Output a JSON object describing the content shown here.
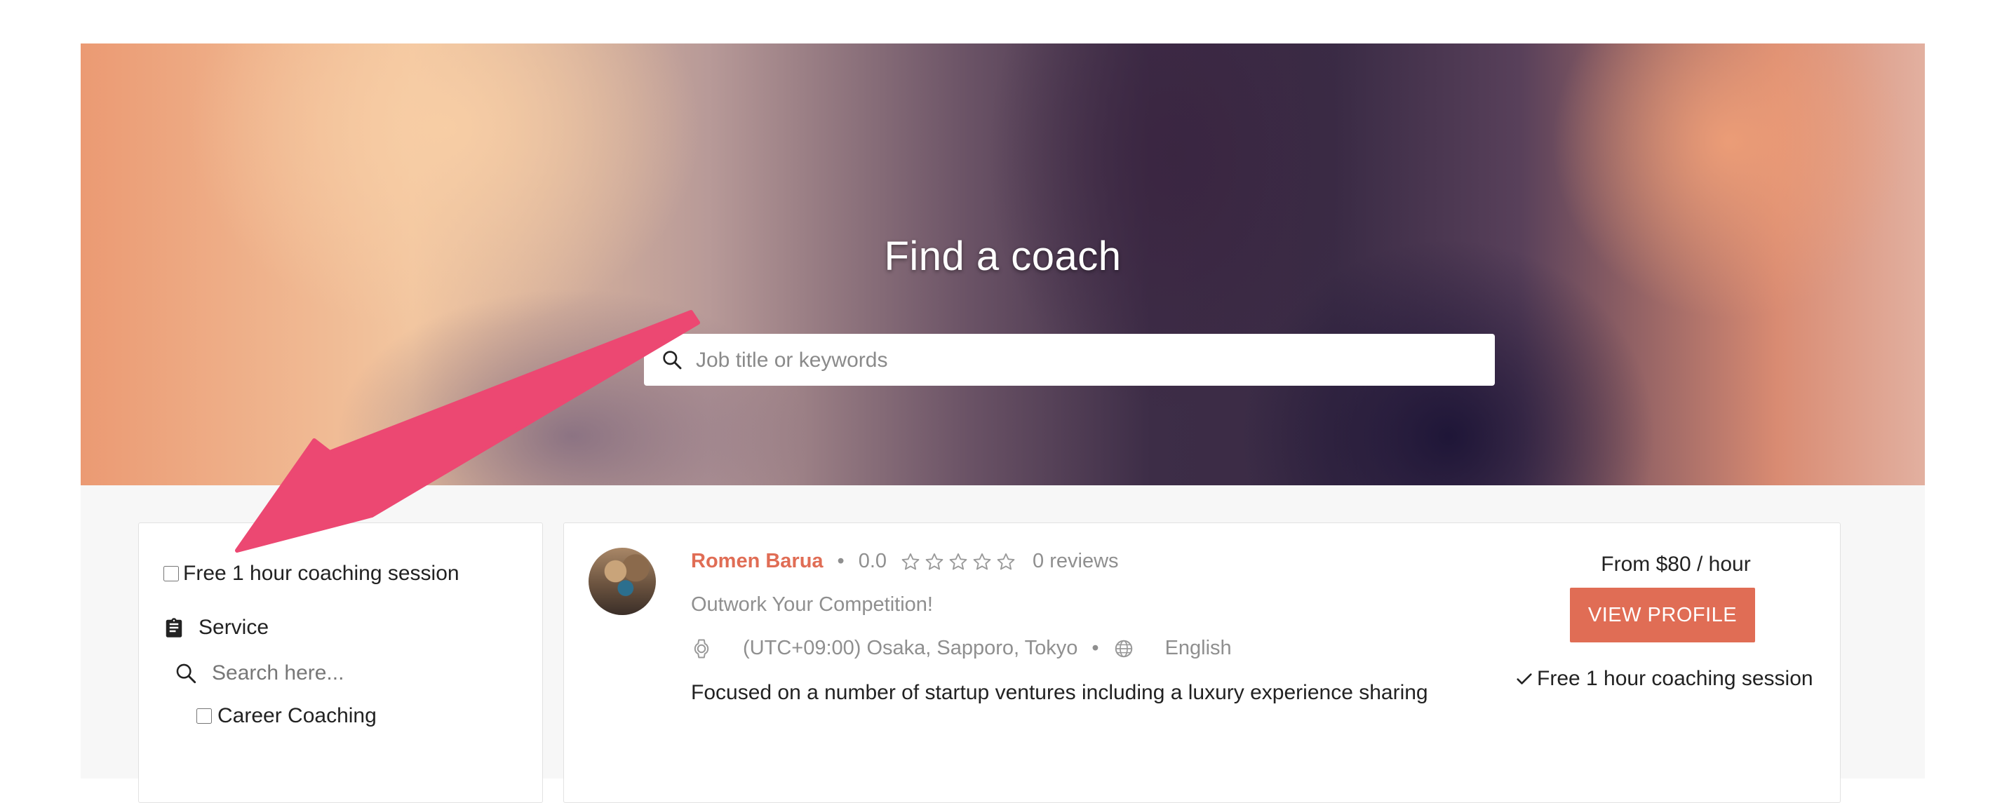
{
  "hero": {
    "title": "Find a coach",
    "search_placeholder": "Job title or keywords"
  },
  "filters": {
    "free_session_label": "Free 1 hour coaching session",
    "free_session_checked": false,
    "service_heading": "Service",
    "service_search_placeholder": "Search here...",
    "service_options": [
      "Career Coaching"
    ]
  },
  "coach": {
    "name": "Romen Barua",
    "rating": "0.0",
    "stars_filled": 0,
    "stars_total": 5,
    "reviews": "0 reviews",
    "tagline": "Outwork Your Competition!",
    "timezone": "(UTC+09:00) Osaka, Sapporo, Tokyo",
    "language": "English",
    "bio": "Focused on a number of startup ventures including a luxury experience sharing",
    "price": "From $80 / hour",
    "view_profile_label": "VIEW PROFILE",
    "free_session_note": "Free 1 hour coaching session",
    "separator": "•"
  },
  "colors": {
    "accent": "#e06d55",
    "annotation_arrow": "#ec4872"
  }
}
